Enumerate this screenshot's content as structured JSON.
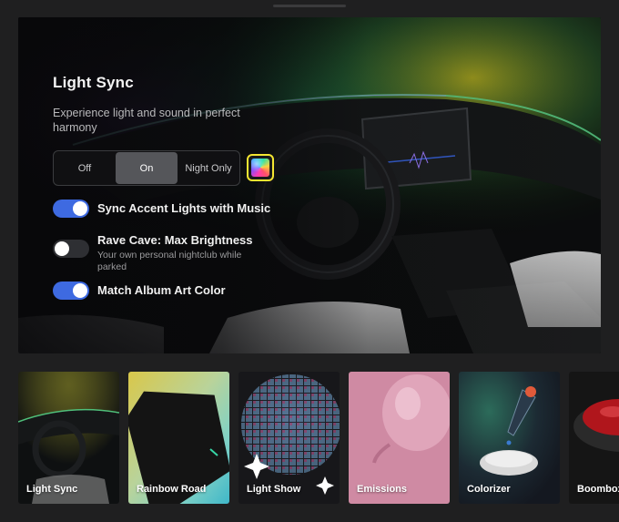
{
  "hero": {
    "title": "Light Sync",
    "subtitle": "Experience light and sound in perfect harmony",
    "mode_options": [
      "Off",
      "On",
      "Night Only"
    ],
    "mode_selected": "On",
    "accent_color": "#3e6ae1",
    "swatch_border_color": "#f3e531"
  },
  "toggles": [
    {
      "label": "Sync Accent Lights with Music",
      "desc": "",
      "state": true
    },
    {
      "label": "Rave Cave: Max Brightness",
      "desc": "Your own personal nightclub while parked",
      "state": false
    },
    {
      "label": "Match Album Art Color",
      "desc": "",
      "state": true
    }
  ],
  "cards": [
    {
      "label": "Light Sync",
      "icon": "car-interior"
    },
    {
      "label": "Rainbow Road",
      "icon": "rainbow-screen"
    },
    {
      "label": "Light Show",
      "icon": "disco-ball"
    },
    {
      "label": "Emissions",
      "icon": "balloon"
    },
    {
      "label": "Colorizer",
      "icon": "dropper"
    },
    {
      "label": "Boombox",
      "icon": "speaker"
    }
  ]
}
